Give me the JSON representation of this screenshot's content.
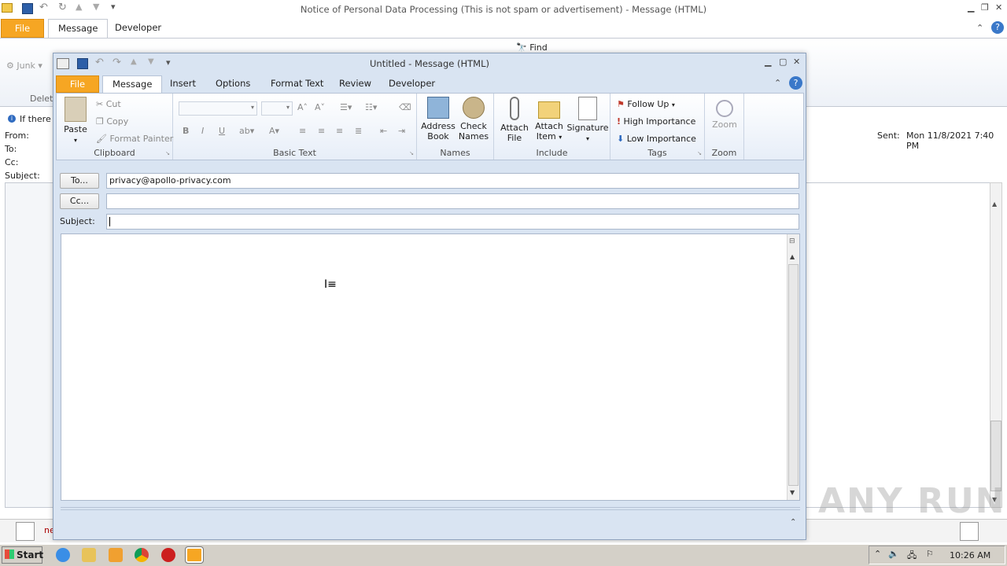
{
  "background_window": {
    "title": "Notice of Personal Data Processing (This is not spam or advertisement)  -  Message (HTML)",
    "tabs": [
      "File",
      "Message",
      "Developer"
    ],
    "ribbon_partial": {
      "junk": "Junk",
      "delete": "Delet",
      "find": "Find"
    },
    "infobar": "If there",
    "headers": {
      "from": "From:",
      "to": "To:",
      "cc": "Cc:",
      "subject": "Subject:",
      "sent_label": "Sent:",
      "sent_value": "Mon 11/8/2021 7:40 PM"
    },
    "people_pane_text": "ne"
  },
  "compose": {
    "title": "Untitled  -  Message (HTML)",
    "tabs": [
      "File",
      "Message",
      "Insert",
      "Options",
      "Format Text",
      "Review",
      "Developer"
    ],
    "clipboard": {
      "paste": "Paste",
      "cut": "Cut",
      "copy": "Copy",
      "format_painter": "Format Painter",
      "label": "Clipboard"
    },
    "basic_text": {
      "label": "Basic Text"
    },
    "names": {
      "address_book": [
        "Address",
        "Book"
      ],
      "check_names": [
        "Check",
        "Names"
      ],
      "label": "Names"
    },
    "include": {
      "attach_file": [
        "Attach",
        "File"
      ],
      "attach_item": [
        "Attach",
        "Item"
      ],
      "signature": "Signature",
      "label": "Include"
    },
    "tags": {
      "follow_up": "Follow Up",
      "high": "High Importance",
      "low": "Low Importance",
      "label": "Tags"
    },
    "zoom": {
      "zoom": "Zoom",
      "label": "Zoom"
    },
    "to_button": "To...",
    "cc_button": "Cc...",
    "subject_label": "Subject:",
    "to_value": "privacy@apollo-privacy.com",
    "cc_value": "",
    "subject_value": ""
  },
  "taskbar": {
    "start": "Start",
    "clock": "10:26 AM"
  },
  "watermark": "ANY RUN",
  "colors": {
    "file_tab": "#f6a623",
    "window_bg": "#d9e4f2"
  }
}
